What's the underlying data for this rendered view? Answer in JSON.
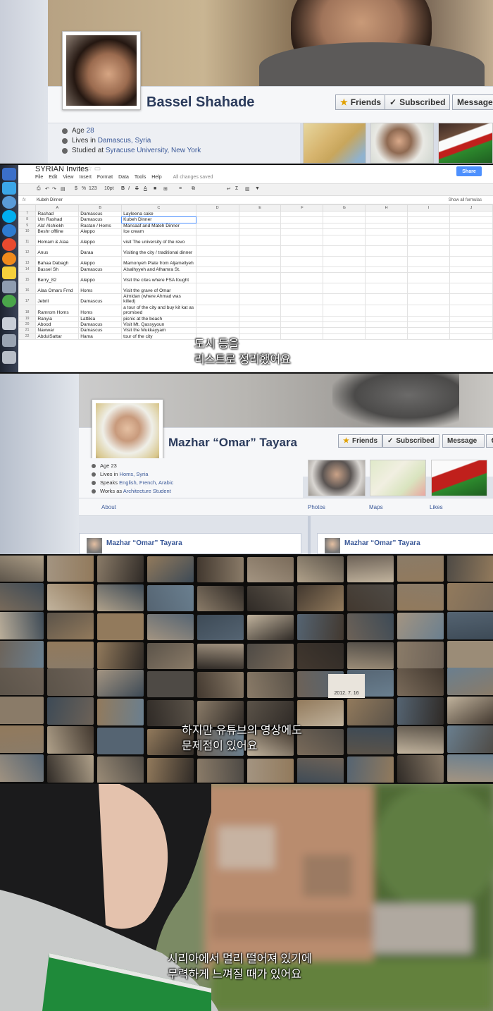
{
  "profile1": {
    "name": "Bassel Shahade",
    "friends_label": "Friends",
    "subscribed_label": "Subscribed",
    "message_label": "Message",
    "age_prefix": "Age",
    "age": "28",
    "lives_prefix": "Lives in",
    "lives": "Damascus, Syria",
    "studied_prefix": "Studied at",
    "studied": "Syracuse University, New York"
  },
  "spreadsheet": {
    "title": "SYRIAN Invites",
    "share_label": "Share",
    "menu": [
      "File",
      "Edit",
      "View",
      "Insert",
      "Format",
      "Data",
      "Tools",
      "Help"
    ],
    "saved_status": "All changes saved",
    "toolbar_zoom": "123",
    "toolbar_font": "10pt",
    "formula_label": "fx",
    "formula_value": "Kubeh Dinner",
    "show_formulas": "Show all formulas",
    "columns": [
      "A",
      "B",
      "C",
      "D",
      "E",
      "F",
      "G",
      "H",
      "I",
      "J"
    ],
    "rows": [
      {
        "n": "7",
        "a": "Rashad",
        "b": "Damascus",
        "c": "Layleena cake"
      },
      {
        "n": "8",
        "a": "Um Rashad",
        "b": "Damascus",
        "c": "Kubeh Dinner"
      },
      {
        "n": "9",
        "a": "Ala' Alshiekh",
        "b": "Rastan / Homs",
        "c": "Mansaaf and Mateh Dinner"
      },
      {
        "n": "10",
        "a": "Beshr offline",
        "b": "Aleppo",
        "c": "Ice cream"
      },
      {
        "n": "11",
        "a": "Homam & Alaa",
        "b": "Aleppo",
        "c": "visit The university of the revo"
      },
      {
        "n": "12",
        "a": "Anus",
        "b": "Daraa",
        "c": "Visiting the city / traditional dinner"
      },
      {
        "n": "13",
        "a": "Bahaa Dabagh",
        "b": "Aleppo",
        "c": "Mamonyeh Plate from Aljamellyeh"
      },
      {
        "n": "14",
        "a": "Bassel Sh",
        "b": "Damascus",
        "c": "Alsalhyyeh and Alhamra St."
      },
      {
        "n": "15",
        "a": "Berry_82",
        "b": "Aleppo",
        "c": "Visit the cites where FSA fought"
      },
      {
        "n": "16",
        "a": "Alaa Omars Frnd",
        "b": "Homs",
        "c": "Visit the grave of Omar"
      },
      {
        "n": "17",
        "a": "Jebril",
        "b": "Damascus",
        "c": "Almidan (where Ahmad was killed)"
      },
      {
        "n": "18",
        "a": "Ramrom Homs",
        "b": "Homs",
        "c": "a tour of the city and buy kit kat as promised"
      },
      {
        "n": "19",
        "a": "Ranyia",
        "b": "Lattikia",
        "c": "picnic at the beach"
      },
      {
        "n": "20",
        "a": "Abood",
        "b": "Damascus",
        "c": "Visit Mt. Qassyyoun"
      },
      {
        "n": "21",
        "a": "Nawwar",
        "b": "Damascus",
        "c": "Visit the Mukkayyam"
      },
      {
        "n": "22",
        "a": "AbdulSattar",
        "b": "Hama",
        "c": "tour of the city"
      }
    ],
    "subtitle_line1": "도시 등을",
    "subtitle_line2": "리스트로 정리했어요"
  },
  "profile2": {
    "name": "Mazhar “Omar” Tayara",
    "friends_label": "Friends",
    "subscribed_label": "Subscribed",
    "message_label": "Message",
    "age_prefix": "Age",
    "age": "23",
    "lives_prefix": "Lives in",
    "lives": "Homs, Syria",
    "speaks_prefix": "Speaks",
    "speaks": "English, French, Arabic",
    "works_prefix": "Works as",
    "works": "Architecture Student",
    "tabs": [
      "About",
      "Photos",
      "Maps",
      "Likes"
    ],
    "card_name": "Mazhar “Omar” Tayara"
  },
  "video_wall": {
    "tile_date": "2012. 7. 16",
    "subtitle_line1": "하지만 유튜브의 영상에도",
    "subtitle_line2": "문제점이 있어요"
  },
  "closing_scene": {
    "subtitle_line1": "시리아에서 멀리 떨어져 있기에",
    "subtitle_line2": "무력하게 느껴질 때가 있어요"
  },
  "colors": {
    "facebook_blue": "#3b5998",
    "share_blue": "#4d90fe",
    "syrian_flag_green": "#2d8a2d"
  }
}
